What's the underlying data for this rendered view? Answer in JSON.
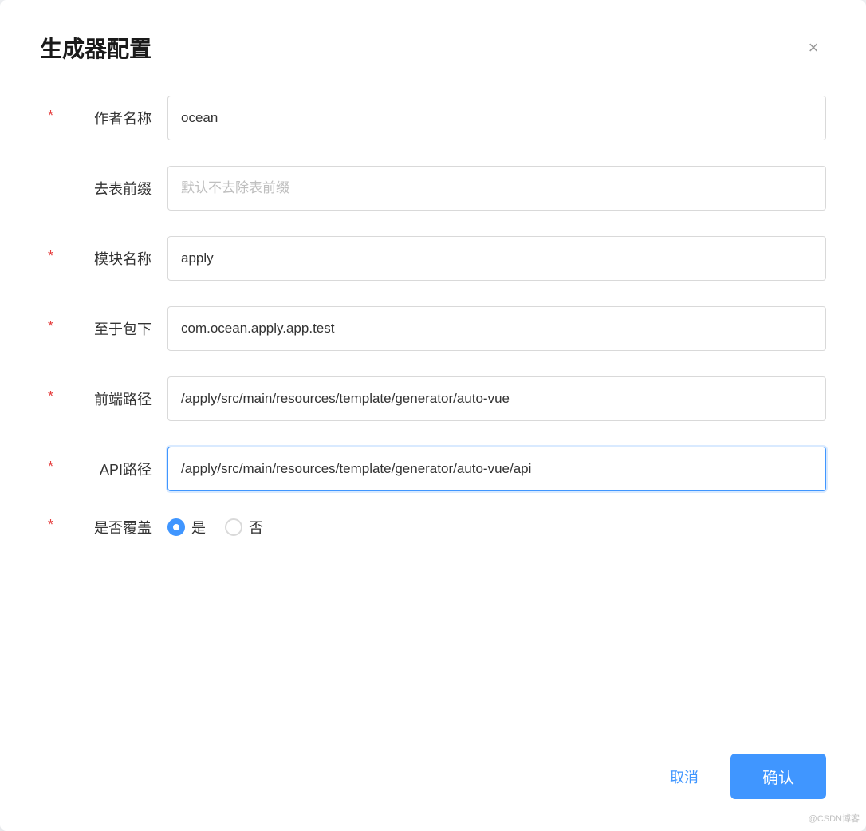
{
  "dialog": {
    "title": "生成器配置",
    "close_label": "×"
  },
  "form": {
    "author": {
      "label": "作者名称",
      "required": true,
      "value": "ocean",
      "placeholder": ""
    },
    "table_prefix": {
      "label": "去表前缀",
      "required": false,
      "value": "",
      "placeholder": "默认不去除表前缀"
    },
    "module_name": {
      "label": "模块名称",
      "required": true,
      "value": "apply",
      "placeholder": ""
    },
    "package": {
      "label": "至于包下",
      "required": true,
      "value": "com.ocean.apply.app.test",
      "placeholder": ""
    },
    "frontend_path": {
      "label": "前端路径",
      "required": true,
      "value": "/apply/src/main/resources/template/generator/auto-vue",
      "placeholder": ""
    },
    "api_path": {
      "label": "API路径",
      "required": true,
      "value": "/apply/src/main/resources/template/generator/auto-vue/api",
      "placeholder": ""
    },
    "overwrite": {
      "label": "是否覆盖",
      "required": true,
      "options": [
        {
          "value": "yes",
          "label": "是",
          "selected": true
        },
        {
          "value": "no",
          "label": "否",
          "selected": false
        }
      ]
    }
  },
  "footer": {
    "cancel_label": "取消",
    "confirm_label": "确认"
  },
  "watermark": "@CSDN博客"
}
